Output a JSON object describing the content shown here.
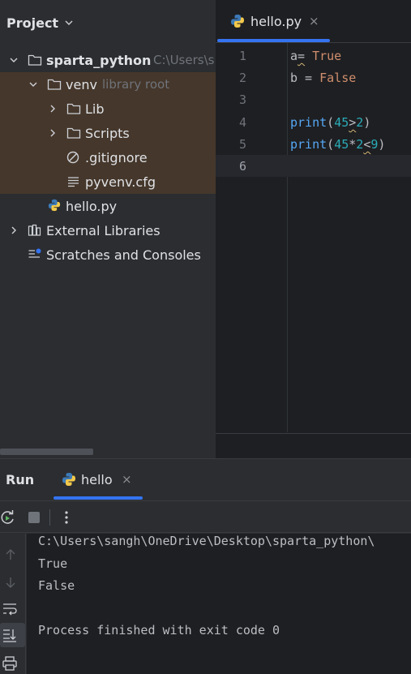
{
  "project_panel": {
    "title": "Project",
    "tree": [
      {
        "label": "sparta_python",
        "hint": "C:\\Users\\s"
      },
      {
        "label": "venv",
        "hint": "library root"
      },
      {
        "label": "Lib"
      },
      {
        "label": "Scripts"
      },
      {
        "label": ".gitignore"
      },
      {
        "label": "pyvenv.cfg"
      },
      {
        "label": "hello.py"
      },
      {
        "label": "External Libraries"
      },
      {
        "label": "Scratches and Consoles"
      }
    ]
  },
  "editor": {
    "tab": {
      "name": "hello.py",
      "close": "×"
    },
    "line_numbers": [
      "1",
      "2",
      "3",
      "4",
      "5",
      "6"
    ],
    "lines": [
      {
        "a": "a",
        "b": "=",
        "c": " ",
        "d": "True"
      },
      {
        "a": "b = ",
        "b": "False"
      },
      {},
      {
        "a": "print",
        "b": "(",
        "c": "45",
        "d": ">",
        "e": "2",
        "f": ")"
      },
      {
        "a": "print",
        "b": "(",
        "c": "45",
        "d": "*",
        "e": "2",
        "f": "<",
        "g": "9",
        "h": ")"
      },
      {}
    ]
  },
  "run": {
    "title": "Run",
    "tab": {
      "name": "hello",
      "close": "×"
    },
    "console": [
      "C:\\Users\\sangh\\OneDrive\\Desktop\\sparta_python\\",
      "True",
      "False",
      "",
      "Process finished with exit code 0"
    ]
  },
  "icons": {
    "folder": "folder-icon",
    "python_file": "python-file-icon",
    "ignore_file": "ignore-file-icon",
    "text_file": "text-file-icon",
    "libraries": "libraries-icon",
    "scratches": "scratches-icon",
    "rerun": "rerun-icon",
    "stop": "stop-icon",
    "more": "more-icon",
    "up": "arrow-up-icon",
    "down": "arrow-down-icon",
    "soft_wrap": "soft-wrap-icon",
    "scroll_to_end": "scroll-to-end-icon",
    "print": "print-icon"
  },
  "colors": {
    "accent": "#3574f0",
    "venv_highlight": "#45372b",
    "keyword": "#cf8e6d",
    "function": "#56a8f5",
    "number": "#2aacb8",
    "warning_squiggle": "#d5b778"
  }
}
